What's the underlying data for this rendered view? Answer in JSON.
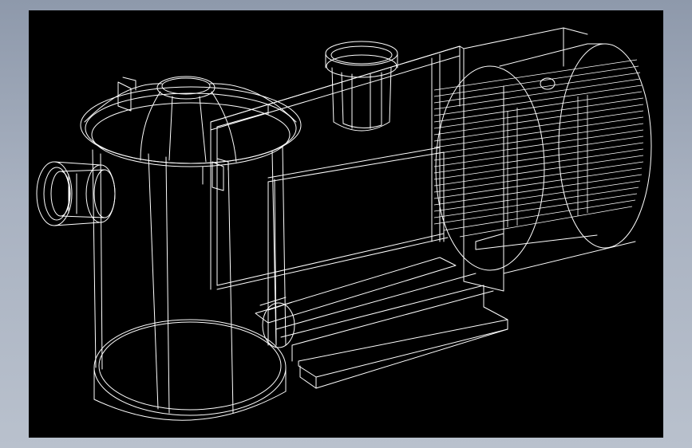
{
  "window": {
    "background_top": "#8e99ab",
    "background_bottom": "#b9c1cd"
  },
  "viewport": {
    "background": "#000000",
    "line_color": "#ffffff",
    "render_style": "wireframe"
  },
  "model": {
    "parts": [
      "strainer-housing",
      "strainer-lid",
      "inlet-flange",
      "outlet-port",
      "pump-body",
      "motor-housing",
      "motor-cooling-fins",
      "base-mount"
    ]
  }
}
